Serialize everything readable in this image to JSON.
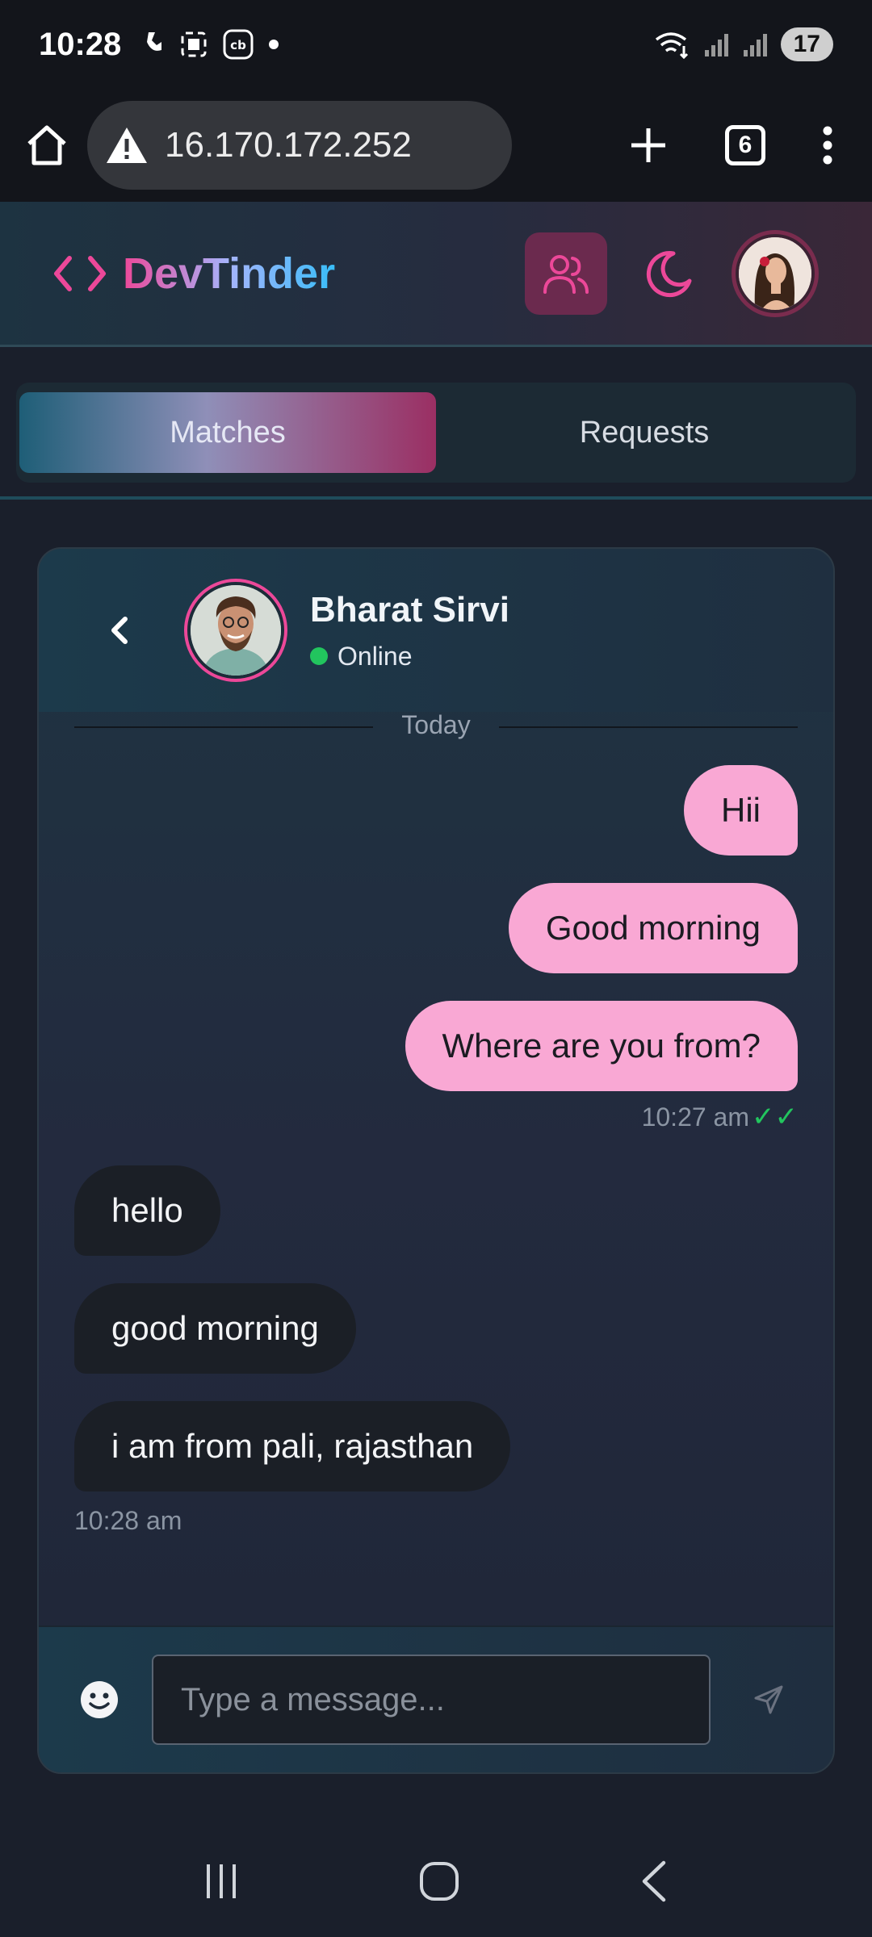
{
  "status_bar": {
    "time": "10:28",
    "battery": "17",
    "icons": [
      "call-forward-icon",
      "screenshot-icon",
      "cb-app-icon",
      "dot-icon",
      "wifi-icon",
      "signal-icon",
      "signal-icon"
    ]
  },
  "browser": {
    "url": "16.170.172.252",
    "tab_count": "6",
    "icons": [
      "home-icon",
      "warning-icon",
      "new-tab-icon",
      "menu-icon"
    ]
  },
  "header": {
    "logo_text": "DevTinder",
    "accent_color": "#ec4899",
    "icons": [
      "code-brackets-icon",
      "users-icon",
      "moon-icon"
    ]
  },
  "tabs": [
    {
      "label": "Matches",
      "active": true
    },
    {
      "label": "Requests",
      "active": false
    }
  ],
  "chat": {
    "contact_name": "Bharat Sirvi",
    "contact_status": "Online",
    "day_separator": "Today",
    "messages": [
      {
        "from": "me",
        "text": "Hii"
      },
      {
        "from": "me",
        "text": "Good morning"
      },
      {
        "from": "me",
        "text": "Where are you from?"
      },
      {
        "from": "them",
        "text": "hello"
      },
      {
        "from": "them",
        "text": "good morning"
      },
      {
        "from": "them",
        "text": "i am from pali, rajasthan"
      }
    ],
    "sent_time": "10:27 am",
    "received_time": "10:28 am",
    "read_receipt": "✓✓"
  },
  "compose": {
    "placeholder": "Type a message..."
  }
}
